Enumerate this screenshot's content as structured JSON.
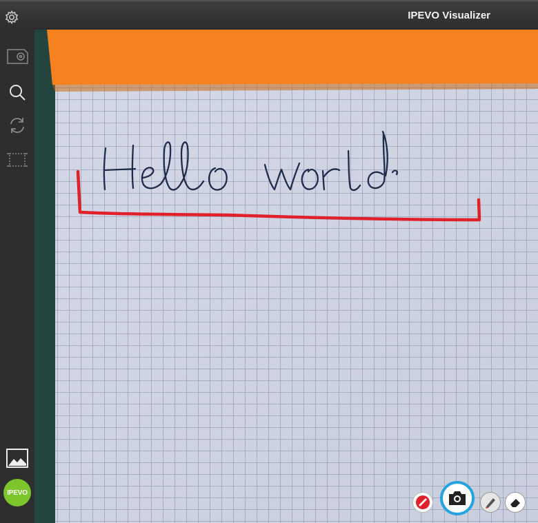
{
  "window": {
    "title": "IPEVO Visualizer"
  },
  "sidebar": {
    "items": [
      {
        "name": "camera-source",
        "icon": "camera-source-icon"
      },
      {
        "name": "zoom",
        "icon": "magnifier-icon"
      },
      {
        "name": "rotate",
        "icon": "rotate-icon"
      },
      {
        "name": "crop",
        "icon": "crop-icon"
      }
    ],
    "gallery_icon": "gallery-icon",
    "logo_text": "IPEVO"
  },
  "camera_view": {
    "handwriting": "Hello world",
    "annotation_color": "#e0202a"
  },
  "toolbar": {
    "tools": [
      "pen-color-icon",
      "capture-camera-icon",
      "pen-icon",
      "eraser-icon"
    ],
    "capture_ring_color": "#25a3dd"
  },
  "colors": {
    "paper_orange": "#f5821f",
    "logo_green": "#7cc52b"
  }
}
